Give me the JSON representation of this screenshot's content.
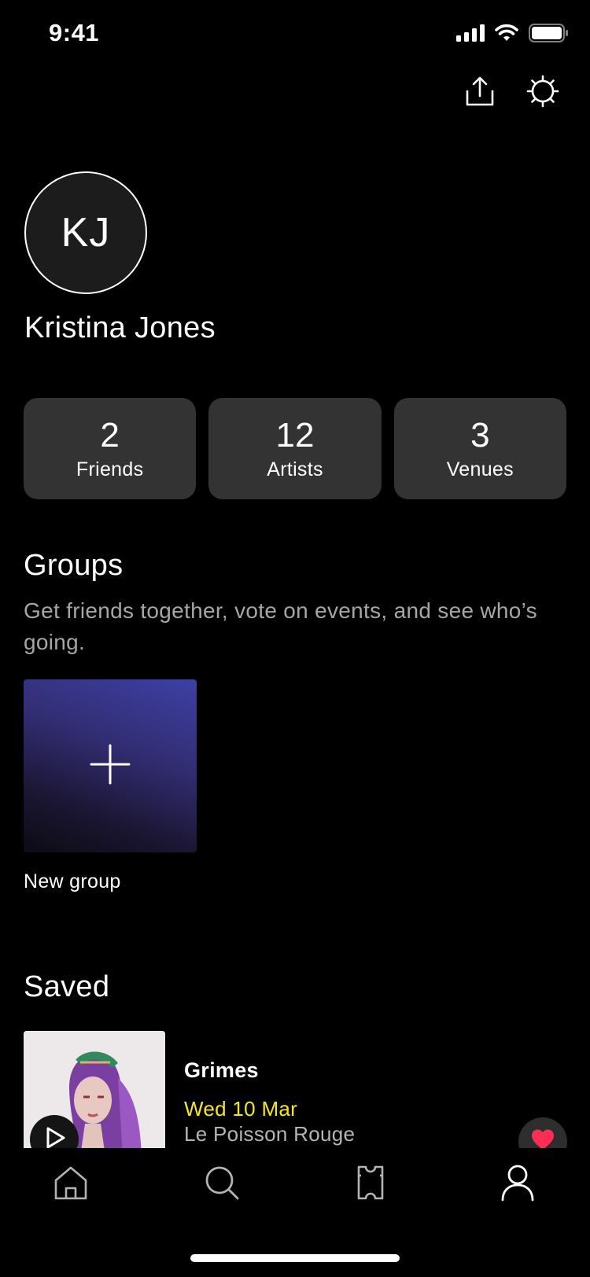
{
  "status_bar": {
    "time": "9:41",
    "icons": [
      "cellular-signal-icon",
      "wifi-icon",
      "battery-icon"
    ]
  },
  "header": {
    "actions": [
      "share-icon",
      "settings-icon"
    ]
  },
  "profile": {
    "initials": "KJ",
    "name": "Kristina Jones"
  },
  "stats": [
    {
      "value": "2",
      "label": "Friends"
    },
    {
      "value": "12",
      "label": "Artists"
    },
    {
      "value": "3",
      "label": "Venues"
    }
  ],
  "groups": {
    "title": "Groups",
    "description": "Get friends together, vote on events, and see who’s going.",
    "new_group_label": "New group"
  },
  "saved": {
    "title": "Saved",
    "items": [
      {
        "artist": "Grimes",
        "date": "Wed 10 Mar",
        "venue": "Le Poisson Rouge"
      }
    ]
  },
  "tabbar": {
    "tabs": [
      "home-icon",
      "search-icon",
      "tickets-icon",
      "profile-icon"
    ],
    "active": "profile"
  },
  "colors": {
    "background": "#000000",
    "card": "#333333",
    "accent_date": "#f4e71e",
    "heart": "#ff2d55",
    "muted_text": "#a6a6a6"
  }
}
